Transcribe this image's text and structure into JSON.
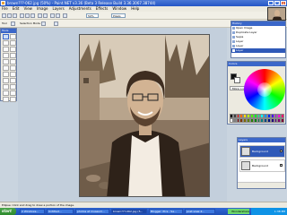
{
  "window": {
    "title": "brown???-062.jpg (50%) - Paint.NET v3.36 (Beta 3 Release Build 3.36.3067.38744)",
    "buttons": [
      "_",
      "□",
      "x"
    ]
  },
  "menu": [
    "File",
    "Edit",
    "View",
    "Image",
    "Layers",
    "Adjustments",
    "Effects",
    "Window",
    "Help"
  ],
  "toolbar": {
    "zoom_value": "50%",
    "zoom_units": "Pixels",
    "tool_label": "Tool",
    "mode_label": "Selection Mode",
    "antialias_label": "Antialiasing"
  },
  "tools_window": {
    "title": "Tools",
    "tools": [
      "rectangle-select",
      "move-selection",
      "lasso",
      "move-selected",
      "ellipse-select",
      "zoom",
      "magic-wand",
      "pan",
      "paint-bucket",
      "gradient",
      "paintbrush",
      "eraser",
      "pencil",
      "color-picker",
      "clone-stamp",
      "recolor",
      "text",
      "line",
      "rectangle",
      "rounded-rectangle",
      "ellipse",
      "freeform"
    ]
  },
  "history_window": {
    "title": "History",
    "items": [
      "Open Image",
      "Duplicate Layer",
      "Sepia",
      "Layer",
      "Layer",
      "Layer"
    ],
    "selected_index": 5
  },
  "colors_window": {
    "title": "Colors",
    "primary": "#111111",
    "secondary": "#ffffff",
    "more_label": "More >>",
    "palette": [
      "#000000",
      "#404040",
      "#ff0000",
      "#ff6a00",
      "#ffd800",
      "#b6ff00",
      "#4cff00",
      "#00ff21",
      "#00ff90",
      "#00ffff",
      "#0094ff",
      "#0026ff",
      "#4800ff",
      "#b200ff",
      "#ff00dc",
      "#ff006e",
      "#ffffff",
      "#808080",
      "#7f0000",
      "#7f3300",
      "#7f6a00",
      "#5b7f00",
      "#267f00",
      "#007f0e",
      "#007f46",
      "#007f7f",
      "#004a7f",
      "#00137f",
      "#21007f",
      "#57007f",
      "#7f006e",
      "#7f0037"
    ]
  },
  "layers_window": {
    "title": "Layers",
    "layers": [
      {
        "name": "Background"
      },
      {
        "name": "Background"
      }
    ]
  },
  "statusbar": {
    "text": "Ellipse: Click and drag to draw a portion of the image."
  },
  "taskbar": {
    "start_label": "start",
    "tasks": [
      "2 Windows...",
      "Untitled...",
      "photos at museum...",
      "brown???-062.jpg (5...",
      "Blogger: Pics - Sa...",
      "post-view-2..."
    ],
    "active_task_index": 3,
    "tray_chip": "Wondershare",
    "clock": "1:38 PM"
  },
  "colors": {
    "accent": "#3b67c9",
    "titlebar": "#2456c6"
  }
}
